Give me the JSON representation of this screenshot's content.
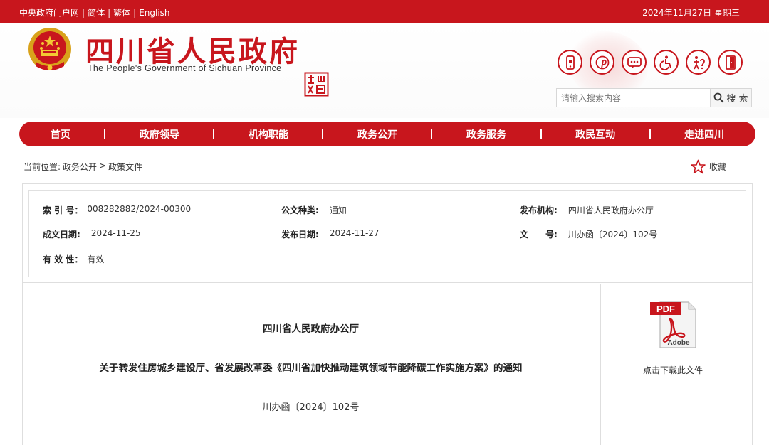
{
  "topbar": {
    "links": [
      "中央政府门户网",
      "简体",
      "繁体",
      "English"
    ],
    "date": "2024年11月27日 星期三"
  },
  "header": {
    "title": "四川省人民政府",
    "subtitle": "The People's Government of Sichuan Province",
    "tools": [
      "mobile-icon",
      "pinterest-icon",
      "message-icon",
      "accessibility-icon",
      "elderly-care-icon",
      "exit-icon"
    ]
  },
  "search": {
    "placeholder": "请输入搜索内容",
    "button_label": "搜 索"
  },
  "nav": {
    "items": [
      "首页",
      "政府领导",
      "机构职能",
      "政务公开",
      "政务服务",
      "政民互动",
      "走进四川"
    ]
  },
  "breadcrumb": {
    "label": "当前位置:",
    "parts": [
      "政务公开",
      ">",
      "政策文件"
    ]
  },
  "favorite": {
    "label": "收藏"
  },
  "meta": {
    "index_label": "索 引 号：",
    "index_value": "008282882/2024-00300",
    "type_label": "公文种类:",
    "type_value": "通知",
    "org_label": "发布机构:",
    "org_value": "四川省人民政府办公厅",
    "made_label": "成文日期:",
    "made_value": "2024-11-25",
    "pub_label": "发布日期:",
    "pub_value": "2024-11-27",
    "docno_label": "文　　号:",
    "docno_value": "川办函〔2024〕102号",
    "valid_label": "有 效 性：",
    "valid_value": "有效"
  },
  "document": {
    "org": "四川省人民政府办公厅",
    "title": "关于转发住房城乡建设厅、省发展改革委《四川省加快推动建筑领域节能降碳工作实施方案》的通知",
    "number": "川办函〔2024〕102号"
  },
  "download": {
    "pdf_text": "PDF",
    "adobe_text": "Adobe",
    "label": "点击下载此文件"
  },
  "colors": {
    "brand_red": "#c8161d"
  }
}
